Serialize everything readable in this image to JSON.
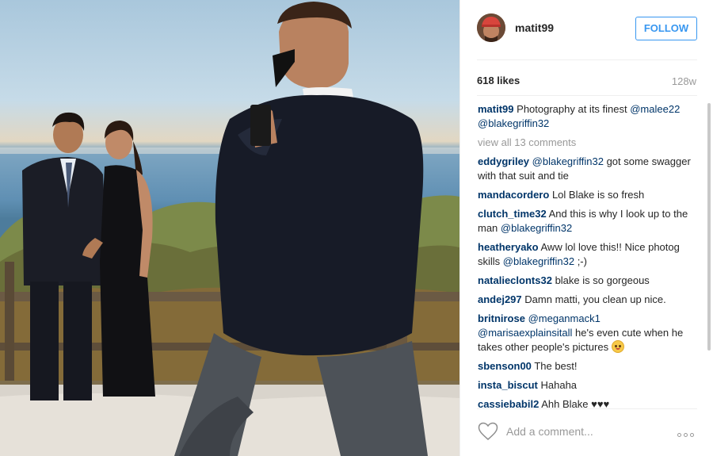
{
  "post": {
    "image_alt": "Photo of a man photographing a couple by the ocean"
  },
  "header": {
    "username": "matit99",
    "follow_label": "FOLLOW"
  },
  "stats": {
    "likes": "618 likes",
    "age": "128w"
  },
  "caption": {
    "user": "matit99",
    "text": " Photography at its finest ",
    "mentions": [
      "@malee22",
      "@blakegriffin32"
    ]
  },
  "view_all": "view all 13 comments",
  "comments": [
    {
      "user": "eddygriley",
      "parts": [
        {
          "m": "@blakegriffin32"
        },
        {
          "t": " got some swagger with that suit and tie"
        }
      ]
    },
    {
      "user": "mandacordero",
      "parts": [
        {
          "t": "Lol Blake is so fresh"
        }
      ]
    },
    {
      "user": "clutch_time32",
      "parts": [
        {
          "t": "And this is why I look up to the man "
        },
        {
          "m": "@blakegriffin32"
        }
      ]
    },
    {
      "user": "heatheryako",
      "parts": [
        {
          "t": "Aww lol love this!! Nice photog skills "
        },
        {
          "m": "@blakegriffin32"
        },
        {
          "t": " ;-)"
        }
      ]
    },
    {
      "user": "natalieclonts32",
      "parts": [
        {
          "t": "blake is so gorgeous"
        }
      ]
    },
    {
      "user": "andej297",
      "parts": [
        {
          "t": "Damn matti, you clean up nice."
        }
      ]
    },
    {
      "user": "britnirose",
      "parts": [
        {
          "m": "@meganmack1"
        },
        {
          "t": " "
        },
        {
          "m": "@marisaexplainsitall"
        },
        {
          "t": " he's even cute when he takes other people's pictures "
        },
        {
          "e": "smiling-face-emoji"
        }
      ]
    },
    {
      "user": "sbenson00",
      "parts": [
        {
          "t": "The best!"
        }
      ]
    },
    {
      "user": "insta_biscut",
      "parts": [
        {
          "t": "Hahaha"
        }
      ]
    },
    {
      "user": "cassiebabil2",
      "parts": [
        {
          "t": "Ahh Blake ♥♥♥"
        }
      ]
    }
  ],
  "composer": {
    "placeholder": "Add a comment...",
    "like_icon": "heart-outline-icon",
    "more_icon": "more-options-icon"
  },
  "colors": {
    "accent": "#3897f0",
    "username": "#003569",
    "muted": "#999999"
  }
}
